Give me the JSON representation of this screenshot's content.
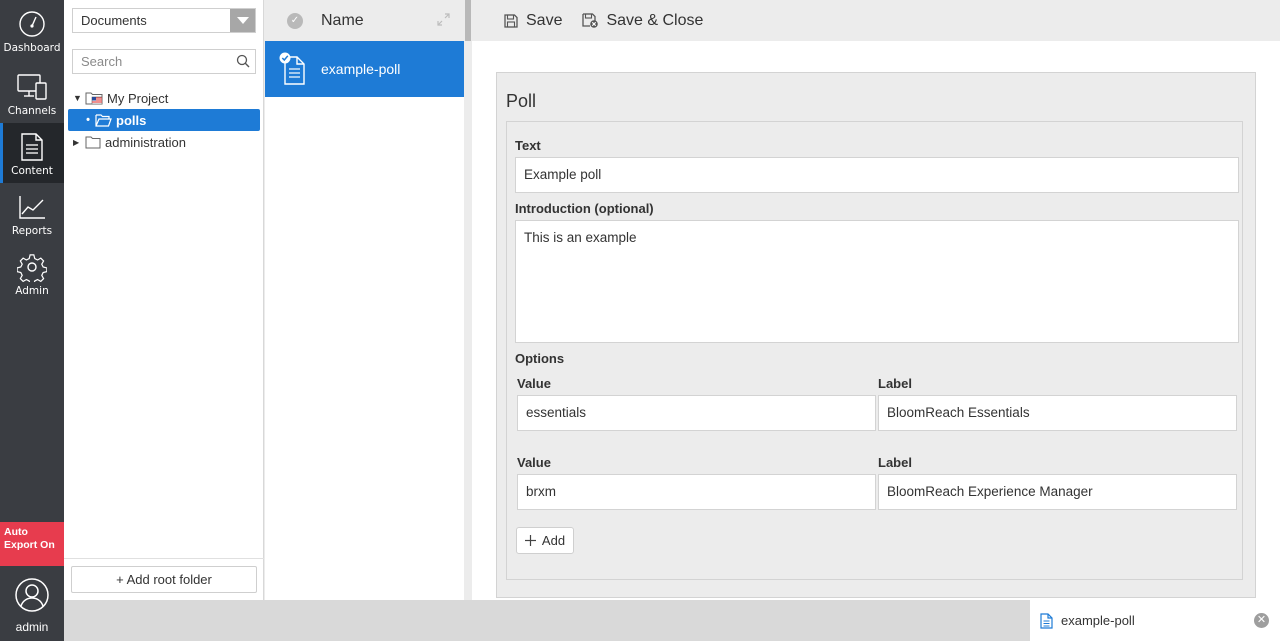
{
  "nav": {
    "items": [
      {
        "label": "Dashboard",
        "icon": "gauge-icon"
      },
      {
        "label": "Channels",
        "icon": "devices-icon"
      },
      {
        "label": "Content",
        "icon": "document-icon"
      },
      {
        "label": "Reports",
        "icon": "line-chart-icon"
      },
      {
        "label": "Admin",
        "icon": "gear-icon"
      }
    ],
    "active": "Content",
    "auto_export": "Auto Export On",
    "auto_export_color": "#e73c4e",
    "user": "admin"
  },
  "tree": {
    "selector_value": "Documents",
    "search_placeholder": "Search",
    "items": [
      {
        "label": "My Project",
        "expanded": true
      },
      {
        "label": "polls",
        "selected": true
      },
      {
        "label": "administration",
        "expanded": false
      }
    ],
    "add_root_label": "+ Add root folder"
  },
  "list": {
    "header_name": "Name",
    "selected_doc": "example-poll"
  },
  "toolbar": {
    "save_label": "Save",
    "save_close_label": "Save & Close"
  },
  "form": {
    "title": "Poll",
    "text_label": "Text",
    "text_value": "Example poll",
    "intro_label": "Introduction (optional)",
    "intro_value": "This is an example",
    "options_label": "Options",
    "options": [
      {
        "value_label": "Value",
        "value": "essentials",
        "label_label": "Label",
        "label": "BloomReach Essentials"
      },
      {
        "value_label": "Value",
        "value": "brxm",
        "label_label": "Label",
        "label": "BloomReach Experience Manager"
      }
    ],
    "add_label": "Add"
  },
  "bottom": {
    "open_tab": "example-poll"
  },
  "colors": {
    "accent": "#1e7bd6",
    "rail": "#3a3d42"
  }
}
